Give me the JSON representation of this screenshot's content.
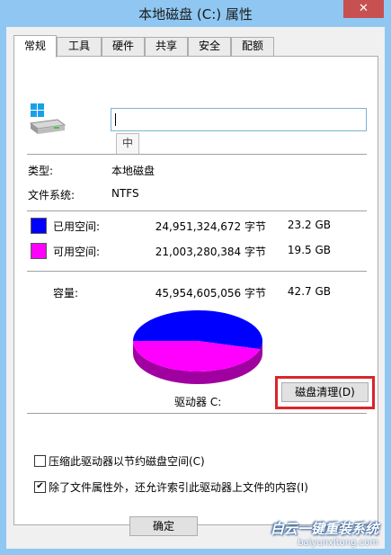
{
  "window": {
    "title": "本地磁盘 (C:) 属性",
    "close_label": "✕"
  },
  "tabs": [
    {
      "label": "常规",
      "active": true
    },
    {
      "label": "工具",
      "active": false
    },
    {
      "label": "硬件",
      "active": false
    },
    {
      "label": "共享",
      "active": false
    },
    {
      "label": "安全",
      "active": false
    },
    {
      "label": "配额",
      "active": false
    }
  ],
  "general": {
    "drive_name_value": "",
    "ime_indicator": "中",
    "type_label": "类型:",
    "type_value": "本地磁盘",
    "fs_label": "文件系统:",
    "fs_value": "NTFS",
    "used": {
      "label": "已用空间:",
      "bytes": "24,951,324,672 字节",
      "size": "23.2 GB",
      "color": "#0000ff",
      "fraction": 0.543
    },
    "free": {
      "label": "可用空间:",
      "bytes": "21,003,280,384 字节",
      "size": "19.5 GB",
      "color": "#ff00ff",
      "fraction": 0.457
    },
    "capacity": {
      "label": "容量:",
      "bytes": "45,954,605,056 字节",
      "size": "42.7 GB"
    },
    "drive_label": "驱动器 C:",
    "cleanup_button": "磁盘清理(D)",
    "compress_label": "压缩此驱动器以节约磁盘空间(C)",
    "compress_checked": false,
    "index_label": "除了文件属性外，还允许索引此驱动器上文件的内容(I)",
    "index_checked": true
  },
  "footer": {
    "ok_label": "确定"
  },
  "watermark": {
    "main": "白云一键重装系统",
    "sub": "baiyunxitong.com"
  }
}
